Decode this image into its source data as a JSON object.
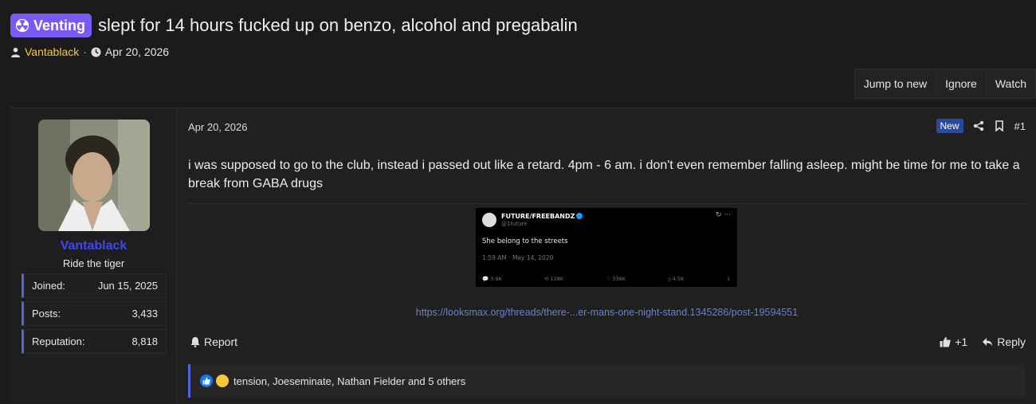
{
  "thread": {
    "prefix": "Venting",
    "title": "slept for 14 hours fucked up on benzo, alcohol and pregabalin",
    "author": "Vantablack",
    "separator": "·",
    "date": "Apr 20, 2026"
  },
  "actions": {
    "jump_to_new": "Jump to new",
    "ignore": "Ignore",
    "watch": "Watch"
  },
  "user": {
    "name": "Vantablack",
    "title": "Ride the tiger",
    "stats": [
      {
        "label": "Joined:",
        "value": "Jun 15, 2025"
      },
      {
        "label": "Posts:",
        "value": "3,433"
      },
      {
        "label": "Reputation:",
        "value": "8,818"
      }
    ]
  },
  "post": {
    "date": "Apr 20, 2026",
    "new_badge": "New",
    "number": "#1",
    "body": "i was supposed to go to the club, instead i passed out like a retard. 4pm - 6 am. i don't even remember falling asleep. might be time for me to take a break from GABA drugs",
    "link": "https://looksmax.org/threads/there-...er-mans-one-night-stand.1345286/post-19594551",
    "report": "Report",
    "like_count": "+1",
    "reply": "Reply",
    "reactions_text": "tension, Joeseminate, Nathan Fielder and 5 others"
  },
  "tweet": {
    "name": "FUTURE/FREEBANDZ",
    "handle": "@1future",
    "text": "She belong to the streets",
    "time": "1:59 AM · May 14, 2020",
    "replies": "3.9K",
    "retweets": "128K",
    "likes": "338K",
    "bookmarks": "4.5K"
  },
  "colors": {
    "prefix_bg": "#7a5af5",
    "author": "#f5c945",
    "username": "#3f48f0",
    "link": "#6b7fd1",
    "accent_border": "#5563d8"
  }
}
